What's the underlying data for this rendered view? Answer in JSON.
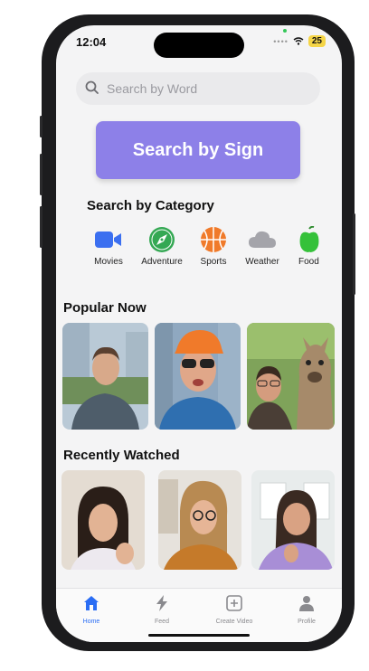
{
  "status_bar": {
    "time": "12:04",
    "battery": "25"
  },
  "search": {
    "placeholder": "Search by Word"
  },
  "sign_button": {
    "label": "Search by Sign"
  },
  "categories": {
    "title": "Search by Category",
    "items": [
      {
        "label": "Movies",
        "icon": "video-camera-icon",
        "color": "#3b6ff0"
      },
      {
        "label": "Adventure",
        "icon": "compass-icon",
        "color": "#34a853"
      },
      {
        "label": "Sports",
        "icon": "basketball-icon",
        "color": "#f07a2a"
      },
      {
        "label": "Weather",
        "icon": "cloud-icon",
        "color": "#9a9aa0"
      },
      {
        "label": "Food",
        "icon": "apple-icon",
        "color": "#35c13a"
      }
    ]
  },
  "popular": {
    "title": "Popular Now"
  },
  "recent": {
    "title": "Recently Watched"
  },
  "tabbar": {
    "items": [
      {
        "label": "Home",
        "icon": "home-icon",
        "active": true
      },
      {
        "label": "Feed",
        "icon": "lightning-icon",
        "active": false
      },
      {
        "label": "Create Video",
        "icon": "plus-square-icon",
        "active": false
      },
      {
        "label": "Profile",
        "icon": "person-icon",
        "active": false
      }
    ]
  },
  "colors": {
    "accent": "#8d80e8",
    "tab_active": "#2a6df4"
  }
}
